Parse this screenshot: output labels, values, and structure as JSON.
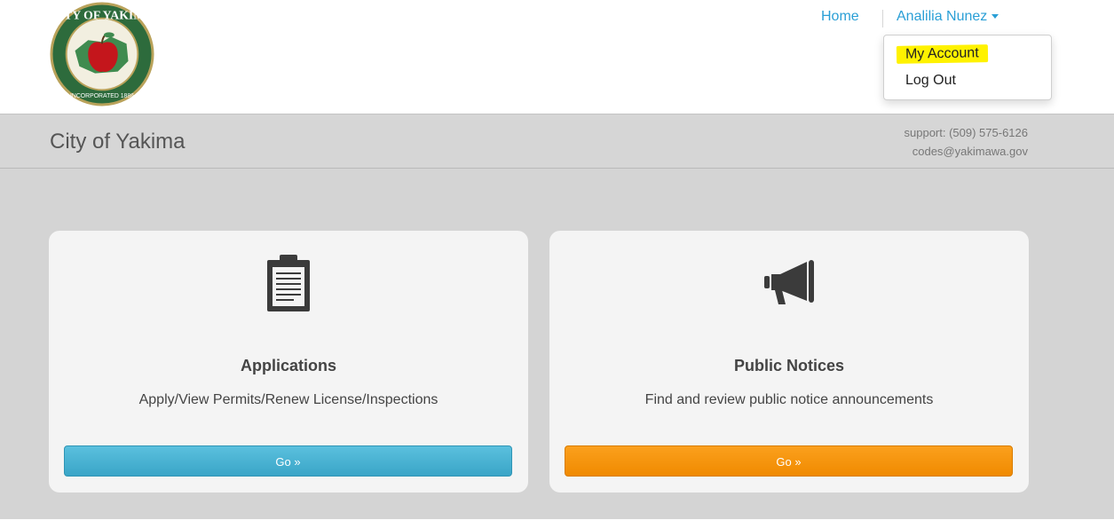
{
  "header": {
    "logo_icon": "city-of-yakima-seal",
    "seal_text_top": "CITY OF YAKIMA",
    "seal_text_bottom": "INCORPORATED 1886",
    "nav": {
      "home_label": "Home",
      "user_label": "Analilia Nunez",
      "user_caret_icon": "caret-down-icon"
    },
    "dropdown": {
      "items": [
        {
          "label": "My Account",
          "highlighted": true
        },
        {
          "label": "Log Out",
          "highlighted": false
        }
      ]
    }
  },
  "band": {
    "title": "City of Yakima",
    "support_phone": "support: (509) 575-6126",
    "support_email": "codes@yakimawa.gov"
  },
  "cards": [
    {
      "icon": "clipboard-icon",
      "title": "Applications",
      "description": "Apply/View Permits/Renew License/Inspections",
      "button_label": "Go »",
      "button_color": "#4eb6d6"
    },
    {
      "icon": "megaphone-icon",
      "title": "Public Notices",
      "description": "Find and review public notice announcements",
      "button_label": "Go »",
      "button_color": "#f5960e"
    }
  ],
  "colors": {
    "link": "#2a9fd6",
    "highlight": "#fff200",
    "band": "#d6d6d6"
  }
}
